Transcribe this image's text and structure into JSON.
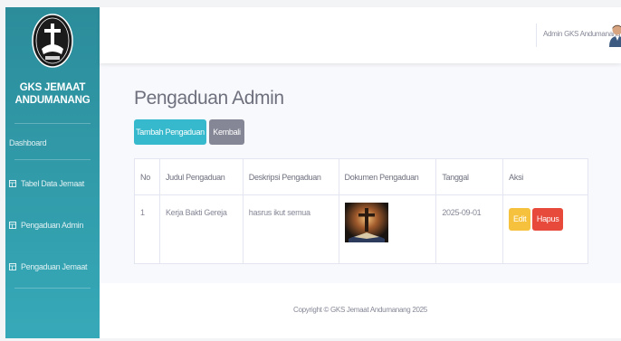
{
  "brand": {
    "name_line1": "GKS JEMAAT",
    "name_line2": "ANDUMANANG",
    "logo_icon": "church-emblem-logo"
  },
  "sidebar": {
    "items": [
      {
        "label": "Dashboard",
        "icon": ""
      },
      {
        "label": "Tabel Data Jemaat",
        "icon": "table-icon"
      },
      {
        "label": "Pengaduan Admin",
        "icon": "table-icon"
      },
      {
        "label": "Pengaduan Jemaat",
        "icon": "table-icon"
      }
    ]
  },
  "topbar": {
    "user_name": "Admin GKS Andumanang",
    "avatar_icon": "user-avatar-icon"
  },
  "page": {
    "title": "Pengaduan Admin",
    "add_button": "Tambah Pengaduan",
    "back_button": "Kembali"
  },
  "table": {
    "headers": [
      "No",
      "Judul Pengaduan",
      "Deskripsi Pengaduan",
      "Dokumen Pengaduan",
      "Tanggal",
      "Aksi"
    ],
    "rows": [
      {
        "no": "1",
        "judul": "Kerja Bakti Gereja",
        "deskripsi": "hasrus ikut semua",
        "dokumen": "cross-image",
        "tanggal": "2025-09-01",
        "edit_label": "Edit",
        "delete_label": "Hapus"
      }
    ]
  },
  "footer": {
    "copyright": "Copyright © GKS Jemaat Andumanang 2025"
  },
  "colors": {
    "sidebar_top": "#2c8c9a",
    "sidebar_bottom": "#36a9b8",
    "info": "#36b9cc",
    "secondary": "#858796",
    "warning": "#f6c23e",
    "danger": "#e74a3b"
  }
}
